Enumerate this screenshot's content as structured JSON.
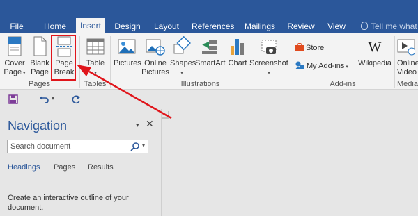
{
  "tabs": [
    {
      "label": "File"
    },
    {
      "label": "Home"
    },
    {
      "label": "Insert"
    },
    {
      "label": "Design"
    },
    {
      "label": "Layout"
    },
    {
      "label": "References"
    },
    {
      "label": "Mailings"
    },
    {
      "label": "Review"
    },
    {
      "label": "View"
    }
  ],
  "tell_me": "Tell me what y",
  "ribbon": {
    "pages": {
      "label": "Pages",
      "cover_page": {
        "line1": "Cover",
        "line2": "Page"
      },
      "blank_page": {
        "line1": "Blank",
        "line2": "Page"
      },
      "page_break": {
        "line1": "Page",
        "line2": "Break"
      }
    },
    "tables": {
      "label": "Tables",
      "table": "Table"
    },
    "illustrations": {
      "label": "Illustrations",
      "pictures": "Pictures",
      "online_pictures": {
        "line1": "Online",
        "line2": "Pictures"
      },
      "shapes": "Shapes",
      "smartart": "SmartArt",
      "chart": "Chart",
      "screenshot": "Screenshot"
    },
    "addins": {
      "label": "Add-ins",
      "store": "Store",
      "my_addins": "My Add-ins",
      "wikipedia": "Wikipedia"
    },
    "media": {
      "label": "Media",
      "online_video": {
        "line1": "Online",
        "line2": "Video"
      }
    }
  },
  "navigation": {
    "title": "Navigation",
    "search_placeholder": "Search document",
    "tabs": [
      {
        "label": "Headings"
      },
      {
        "label": "Pages"
      },
      {
        "label": "Results"
      }
    ],
    "description": "Create an interactive outline of your document."
  },
  "colors": {
    "accent": "#2b579a",
    "highlight": "#e0151b"
  }
}
